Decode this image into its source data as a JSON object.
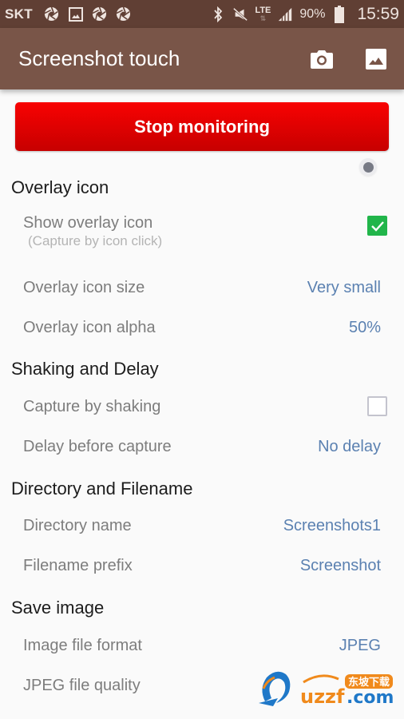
{
  "status_bar": {
    "carrier": "SKT",
    "notification_icons": [
      "shutter-icon",
      "image-icon",
      "shutter-icon",
      "shutter-icon"
    ],
    "network": "LTE",
    "battery": "90%",
    "time": "15:59"
  },
  "app_bar": {
    "title": "Screenshot touch",
    "actions": [
      {
        "icon": "camera-icon",
        "label": "Capture"
      },
      {
        "icon": "gallery-icon",
        "label": "Gallery"
      }
    ],
    "background_color": "#795548"
  },
  "main": {
    "stop_button_label": "Stop monitoring",
    "stop_button_color": "#e60000",
    "sections": [
      {
        "header": "Overlay icon",
        "items": [
          {
            "title": "Show overlay icon",
            "summary": "(Capture by icon click)",
            "type": "checkbox",
            "checked": true
          },
          {
            "title": "Overlay icon size",
            "value": "Very small"
          },
          {
            "title": "Overlay icon alpha",
            "value": "50%"
          }
        ]
      },
      {
        "header": "Shaking and Delay",
        "items": [
          {
            "title": "Capture by shaking",
            "type": "checkbox",
            "checked": false
          },
          {
            "title": "Delay before capture",
            "value": "No delay"
          }
        ]
      },
      {
        "header": "Directory and Filename",
        "items": [
          {
            "title": "Directory name",
            "value": "Screenshots1"
          },
          {
            "title": "Filename prefix",
            "value": "Screenshot"
          }
        ]
      },
      {
        "header": "Save image",
        "items": [
          {
            "title": "Image file format",
            "value": "JPEG"
          },
          {
            "title": "JPEG file quality",
            "value": ""
          }
        ]
      }
    ]
  },
  "watermark": {
    "text": "uzzf.com",
    "cn_text": "东坡下载"
  },
  "colors": {
    "status_bar": "#603f34",
    "value_text": "#5b81b1",
    "checkbox_checked": "#21b54a"
  }
}
